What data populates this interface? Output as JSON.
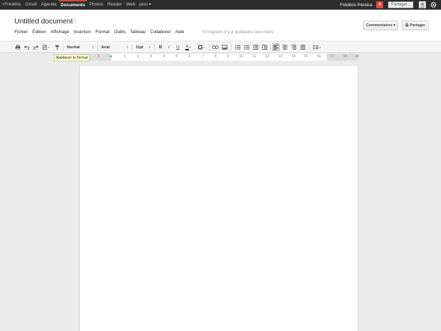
{
  "gbar": {
    "links": [
      "+Frédéric",
      "Gmail",
      "Agenda",
      "Documents",
      "Photos",
      "Reader",
      "Web",
      "plus ▾"
    ],
    "active_index": 3,
    "user": "Frédéric Pereira",
    "notifications": "4",
    "share_label": "Partager..."
  },
  "doc": {
    "title": "Untitled document",
    "saved_status": "Enregistré il y a quelques secondes"
  },
  "buttons": {
    "comments": "Commentaires ▾",
    "share": "Partager"
  },
  "menu": [
    "Fichier",
    "Édition",
    "Affichage",
    "Insertion",
    "Format",
    "Outils",
    "Tableau",
    "Collaborer",
    "Aide"
  ],
  "toolbar": {
    "style": "Normal",
    "font": "Arial",
    "size": "11pt",
    "bold": "B",
    "italic": "I",
    "underline": "U",
    "text_color": "A"
  },
  "tooltip": "Appliquer le format",
  "ruler": {
    "numbers": [
      "2",
      "1",
      "1",
      "2",
      "3",
      "4",
      "5",
      "6",
      "7",
      "8",
      "9",
      "10",
      "11",
      "12",
      "13",
      "14",
      "15",
      "16",
      "17",
      "18",
      "19"
    ]
  },
  "colors": {
    "accent": "#dd4b39",
    "link_blue": "#4d90fe"
  }
}
